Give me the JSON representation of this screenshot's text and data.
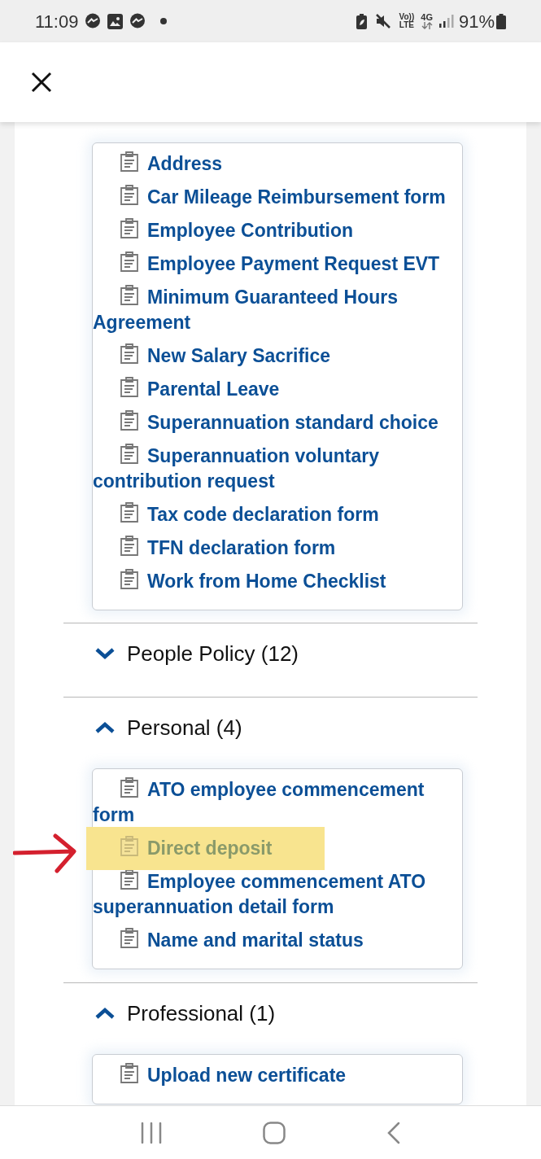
{
  "status_bar": {
    "time": "11:09",
    "volte": "Vo))",
    "lte": "LTE",
    "network": "4G",
    "battery": "91%"
  },
  "sections": [
    {
      "items": [
        {
          "label": "Address",
          "highlighted": false
        },
        {
          "label": "Car Mileage Reimbursement form",
          "highlighted": false
        },
        {
          "label": "Employee Contribution",
          "highlighted": false
        },
        {
          "label": "Employee Payment Request EVT",
          "highlighted": false
        },
        {
          "label": "Minimum Guaranteed Hours Agreement",
          "highlighted": false
        },
        {
          "label": "New Salary Sacrifice",
          "highlighted": false
        },
        {
          "label": "Parental Leave",
          "highlighted": false
        },
        {
          "label": "Superannuation standard choice",
          "highlighted": false
        },
        {
          "label": "Superannuation voluntary contribution request",
          "highlighted": false
        },
        {
          "label": "Tax code declaration form",
          "highlighted": false
        },
        {
          "label": "TFN declaration form",
          "highlighted": false
        },
        {
          "label": "Work from Home Checklist",
          "highlighted": false
        }
      ]
    },
    {
      "title": "People Policy (12)",
      "expanded": false
    },
    {
      "title": "Personal (4)",
      "expanded": true,
      "items": [
        {
          "label": "ATO employee commencement form",
          "highlighted": false
        },
        {
          "label": "Direct deposit",
          "highlighted": true
        },
        {
          "label": "Employee commencement ATO superannuation detail form",
          "highlighted": false
        },
        {
          "label": "Name and marital status",
          "highlighted": false
        }
      ]
    },
    {
      "title": "Professional (1)",
      "expanded": true,
      "items": [
        {
          "label": "Upload new certificate",
          "highlighted": false
        }
      ]
    }
  ]
}
